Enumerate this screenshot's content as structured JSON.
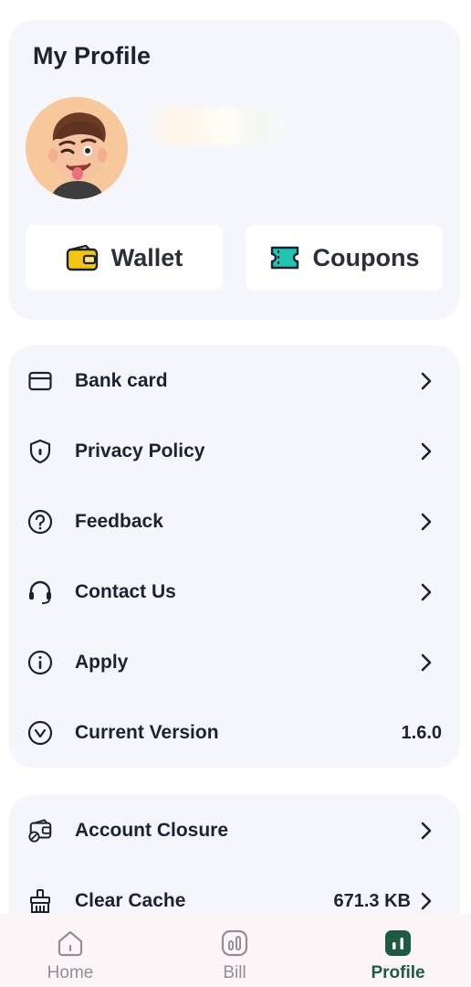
{
  "profile": {
    "title": "My Profile",
    "user_name": "",
    "avatar_icon": "memoji-avatar-icon"
  },
  "quick_actions": [
    {
      "label": "Wallet",
      "icon": "wallet-icon",
      "accent": "#f3c514"
    },
    {
      "label": "Coupons",
      "icon": "coupon-ticket-icon",
      "accent": "#22c3b1"
    }
  ],
  "menu_main": [
    {
      "label": "Bank card",
      "icon": "bank-card-icon",
      "value": "",
      "chevron": true
    },
    {
      "label": "Privacy Policy",
      "icon": "shield-icon",
      "value": "",
      "chevron": true
    },
    {
      "label": "Feedback",
      "icon": "question-icon",
      "value": "",
      "chevron": true
    },
    {
      "label": "Contact Us",
      "icon": "headset-icon",
      "value": "",
      "chevron": true
    },
    {
      "label": "Apply",
      "icon": "info-icon",
      "value": "",
      "chevron": true
    },
    {
      "label": "Current Version",
      "icon": "version-icon",
      "value": "1.6.0",
      "chevron": false
    }
  ],
  "menu_secondary": [
    {
      "label": "Account Closure",
      "icon": "account-closure-icon",
      "value": "",
      "chevron": true
    },
    {
      "label": "Clear Cache",
      "icon": "broom-icon",
      "value": "671.3 KB",
      "chevron": true
    }
  ],
  "bottom_nav": [
    {
      "label": "Home",
      "icon": "home-icon",
      "active": false
    },
    {
      "label": "Bill",
      "icon": "bill-icon",
      "active": false
    },
    {
      "label": "Profile",
      "icon": "profile-chart-icon",
      "active": true
    }
  ],
  "colors": {
    "card_bg": "#f5f6fb",
    "text": "#1d2230",
    "active_nav": "#1f5b44",
    "nav_bg": "#fcf5f8"
  }
}
